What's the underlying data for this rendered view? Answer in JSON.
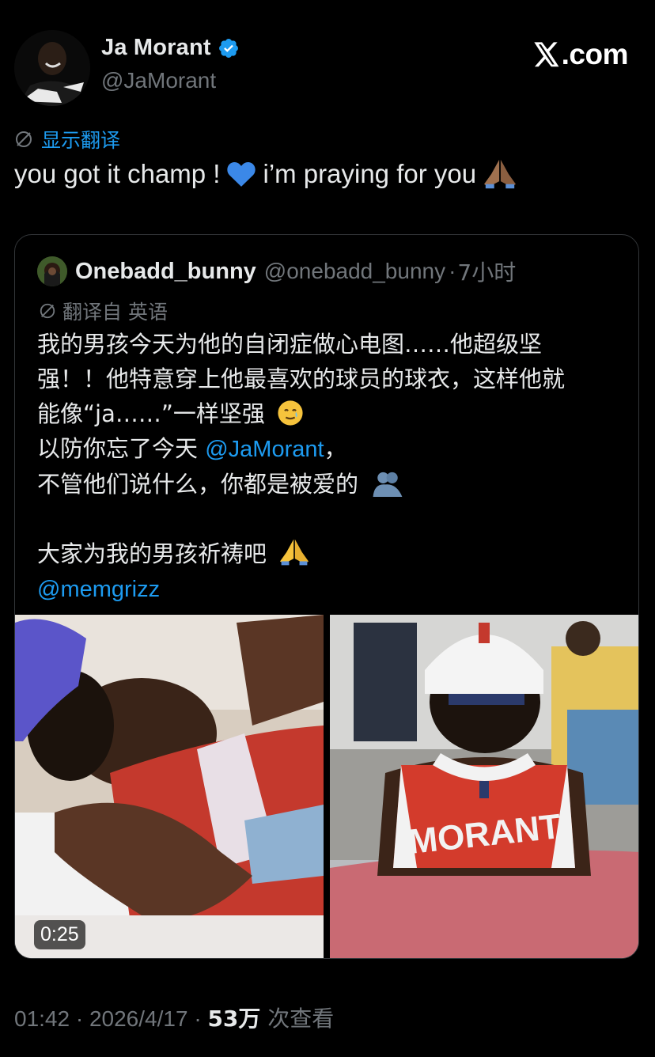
{
  "author": {
    "display_name": "Ja Morant",
    "handle": "@JaMorant",
    "verified": true
  },
  "brand": {
    "domain": ".com",
    "logo_icon": "x-logo-icon"
  },
  "translate": {
    "label": "显示翻译",
    "icon": "translate-icon"
  },
  "tweet": {
    "text_part1": "you got it champ !",
    "emoji1": "blue-heart-icon",
    "text_part2": "i’m praying for you",
    "emoji2": "praying-hands-icon"
  },
  "quote": {
    "display_name": "Onebadd_bunny",
    "handle": "@onebadd_bunny",
    "separator": "·",
    "time": "7小时",
    "translated_from": "翻译自 英语",
    "lines": {
      "l1": "我的男孩今天为他的自闭症做心电图……他超级坚",
      "l2": "强！！他特意穿上他最喜欢的球员的球衣，这样他就",
      "l3": "能像“ja……”一样坚强",
      "l4_prefix": "以防你忘了今天 ",
      "l4_mention": "@JaMorant",
      "l4_suffix": "，",
      "l5": "不管他们说什么，你都是被爱的",
      "l6": "大家为我的男孩祈祷吧",
      "l7_mention": "@memgrizz"
    },
    "media": {
      "video_duration": "0:25",
      "jersey_text": "MORANT"
    }
  },
  "footer": {
    "time": "01:42",
    "sep1": " · ",
    "date": "2026/4/17",
    "sep2": " · ",
    "views": "53万",
    "views_label": " 次查看"
  },
  "colors": {
    "background": "#000000",
    "text": "#e7e9ea",
    "muted": "#71767b",
    "link": "#1d9bf0",
    "border": "#333639"
  }
}
